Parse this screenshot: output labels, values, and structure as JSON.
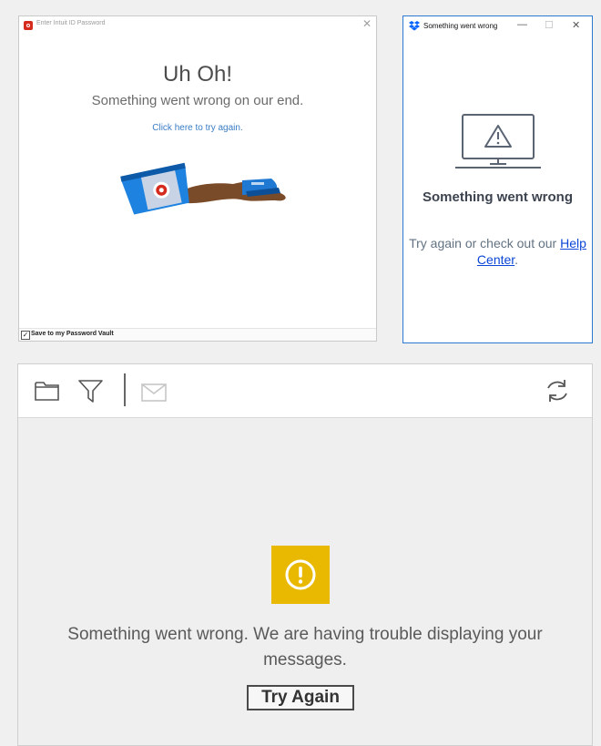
{
  "intuit_window": {
    "title": "Enter Intuit ID Password",
    "icon": "intuit-app-icon",
    "close_glyph": "✕",
    "heading": "Uh Oh!",
    "subtitle": "Something went wrong on our end.",
    "retry_link": "Click here to try again.",
    "illustration": "spilled-coffee-cup",
    "footer": {
      "checkbox_checked": true,
      "checkbox_glyph": "✓",
      "label": "Save to my Password Vault"
    }
  },
  "dropbox_window": {
    "title": "Something went wrong",
    "icon": "dropbox-icon",
    "controls": {
      "minimize": "—",
      "maximize": "☐",
      "close": "✕"
    },
    "illustration": "monitor-warning-icon",
    "heading": "Something went wrong",
    "desc_prefix": "Try again or check out our",
    "help_link": "Help Center",
    "desc_suffix": "."
  },
  "messages_pane": {
    "toolbar": [
      "folder-icon",
      "filter-icon",
      "mail-icon",
      "refresh-icon"
    ],
    "alert_icon": "exclamation-circle-icon",
    "message": "Something went wrong. We are having trouble displaying your messages.",
    "button": "Try Again"
  },
  "colors": {
    "intuit_red": "#d52b1e",
    "link_blue": "#3a7cc5",
    "dropbox_blue": "#0061fe",
    "warning_yellow": "#e8b900"
  }
}
